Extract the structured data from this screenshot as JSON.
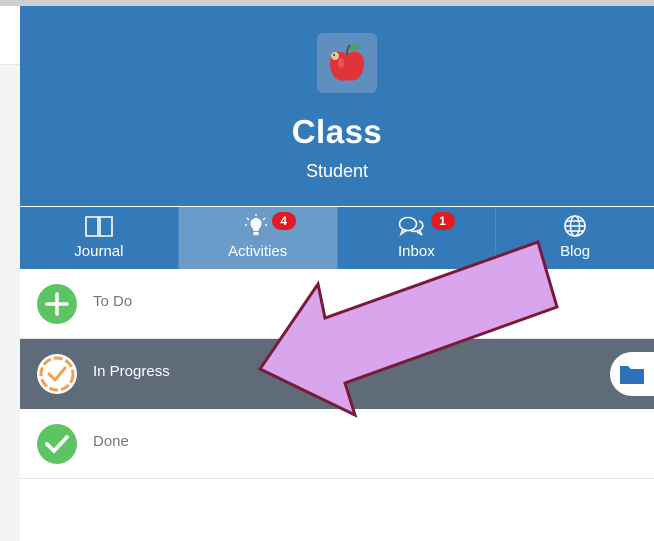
{
  "header": {
    "title": "Class",
    "subtitle": "Student",
    "logo_icon": "apple-with-worm-icon"
  },
  "tabs": [
    {
      "label": "Journal",
      "icon": "book-icon",
      "badge": null,
      "active": false
    },
    {
      "label": "Activities",
      "icon": "lightbulb-icon",
      "badge": "4",
      "active": true
    },
    {
      "label": "Inbox",
      "icon": "chat-bubbles-icon",
      "badge": "1",
      "active": false
    },
    {
      "label": "Blog",
      "icon": "globe-icon",
      "badge": null,
      "active": false
    }
  ],
  "list": {
    "items": [
      {
        "label": "To Do",
        "icon": "plus-circle-icon",
        "selected": false
      },
      {
        "label": "In Progress",
        "icon": "in-progress-check-icon",
        "selected": true
      },
      {
        "label": "Done",
        "icon": "check-circle-icon",
        "selected": false
      }
    ],
    "folder_icon": "folder-icon"
  },
  "colors": {
    "header_bg": "#357ab8",
    "active_tab_bg": "#6b9bc9",
    "badge": "#e11b22",
    "selected_row_bg": "#5f6b79",
    "green": "#5cc462",
    "orange": "#f5a04a",
    "annotation_arrow_fill": "#d9a6ee",
    "annotation_arrow_stroke": "#7a1a3a"
  }
}
